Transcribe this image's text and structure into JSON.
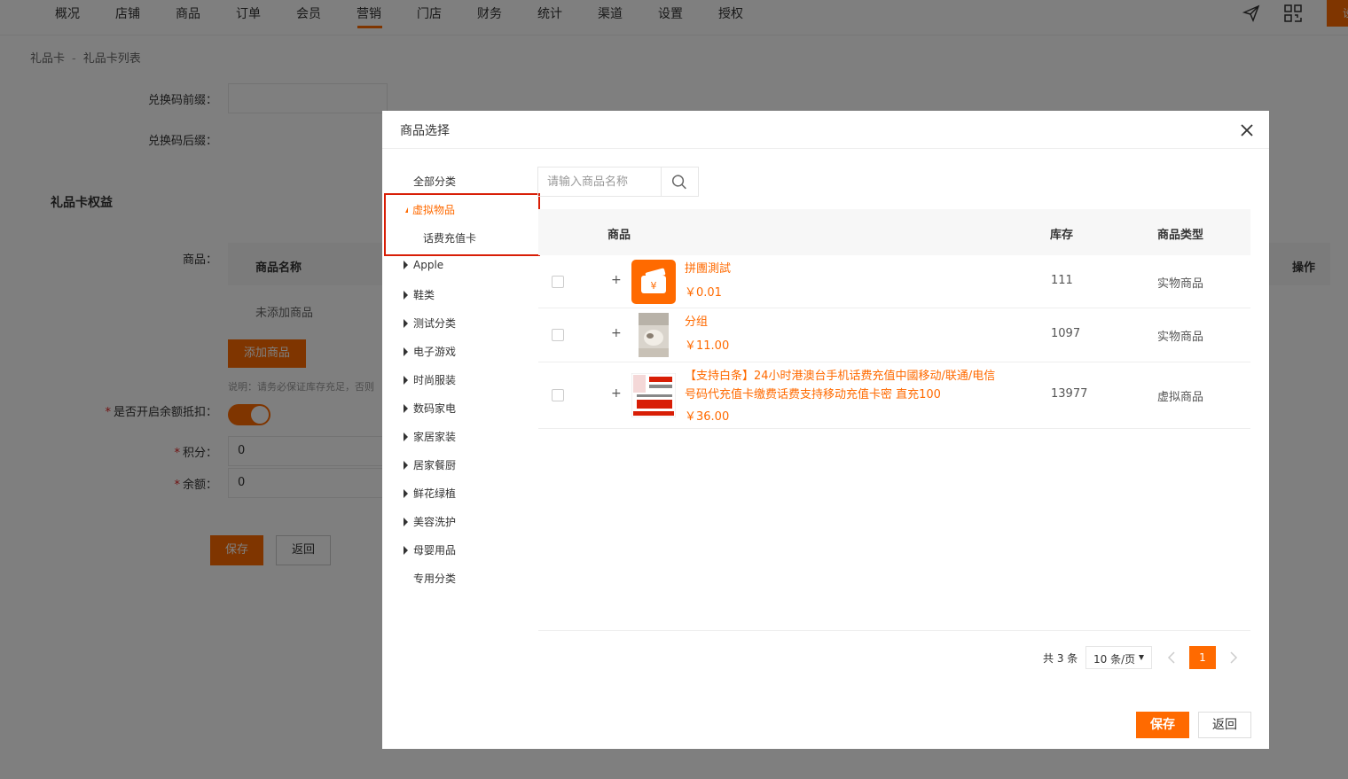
{
  "topnav": {
    "items": [
      "概况",
      "店铺",
      "商品",
      "订单",
      "会员",
      "营销",
      "门店",
      "财务",
      "统计",
      "渠道",
      "设置",
      "授权"
    ],
    "active_index": 5,
    "right_tab_label": "设"
  },
  "breadcrumb": {
    "parent": "礼品卡",
    "separator": "-",
    "current": "礼品卡列表"
  },
  "form": {
    "prefix_label": "兑换码前缀：",
    "suffix_label": "兑换码后缀：",
    "section_title": "礼品卡权益",
    "goods_label": "商品：",
    "goods_col_name": "商品名称",
    "goods_col_action": "操作",
    "goods_empty": "未添加商品",
    "add_goods_button": "添加商品",
    "note": "说明：请务必保证库存充足，否则",
    "balance_deduct_label": "是否开启余额抵扣：",
    "points_label": "积分：",
    "points_value": "0",
    "balance_label": "余额：",
    "balance_value": "0",
    "save_button": "保存",
    "back_button": "返回"
  },
  "modal": {
    "title": "商品选择",
    "categories": {
      "all": "全部分类",
      "virtual": "虚拟物品",
      "virtual_child": "话费充值卡",
      "apple": "Apple",
      "shoes": "鞋类",
      "test": "测试分类",
      "games": "电子游戏",
      "fashion": "时尚服装",
      "digital": "数码家电",
      "home": "家居家装",
      "kitchen": "居家餐厨",
      "flowers": "鲜花绿植",
      "beauty": "美容洗护",
      "baby": "母婴用品",
      "special": "专用分类"
    },
    "search": {
      "placeholder": "请输入商品名称",
      "value": ""
    },
    "table": {
      "headers": {
        "product": "商品",
        "stock": "库存",
        "type": "商品类型"
      },
      "rows": [
        {
          "name": "拼團測試",
          "price": "￥0.01",
          "stock": "111",
          "type": "实物商品"
        },
        {
          "name": "分组",
          "price": "￥11.00",
          "stock": "1097",
          "type": "实物商品"
        },
        {
          "name_line1": "【支持白条】24小时港澳台手机话费充值中國移动/联通/电信",
          "name_line2": "号码代充值卡缴费话费支持移动充值卡密 直充100",
          "price": "￥36.00",
          "stock": "13977",
          "type": "虚拟商品"
        }
      ]
    },
    "pager": {
      "total": "共 3 条",
      "page_size": "10 条/页",
      "current_page": "1"
    },
    "save_button": "保存",
    "back_button": "返回"
  },
  "colors": {
    "accent": "#ff6a00",
    "highlight_border": "#d81e06"
  }
}
